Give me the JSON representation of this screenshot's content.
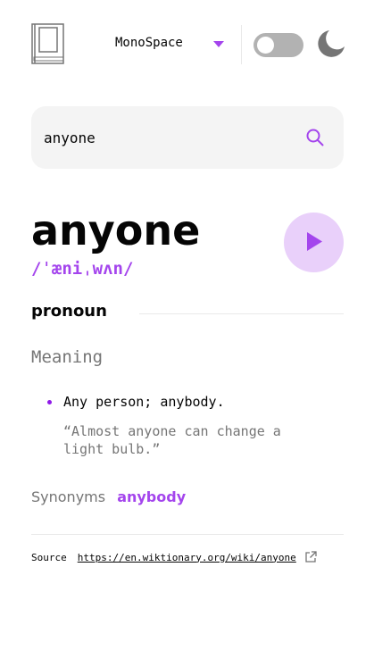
{
  "header": {
    "logo_icon": "book-icon",
    "font": {
      "selected": "MonoSpace",
      "chevron_icon": "chevron-down-icon"
    },
    "theme_toggle": {
      "state": "off"
    },
    "theme_icon": "moon-icon"
  },
  "search": {
    "value": "anyone",
    "icon": "search-icon"
  },
  "entry": {
    "word": "anyone",
    "phonetic": "/ˈæniˌwʌn/",
    "play_icon": "play-icon",
    "part_of_speech": "pronoun",
    "meaning_heading": "Meaning",
    "definitions": [
      {
        "text": "Any person; anybody.",
        "example": "“Almost anyone can change a light bulb.”"
      }
    ],
    "synonyms_label": "Synonyms",
    "synonyms": [
      "anybody"
    ]
  },
  "source": {
    "label": "Source",
    "url": "https://en.wiktionary.org/wiki/anyone",
    "icon": "external-link-icon"
  },
  "colors": {
    "accent": "#a445ed",
    "play_bg": "#e9d0fa",
    "muted": "#757575",
    "divider": "#e9e9e9",
    "search_bg": "#f4f4f4"
  }
}
